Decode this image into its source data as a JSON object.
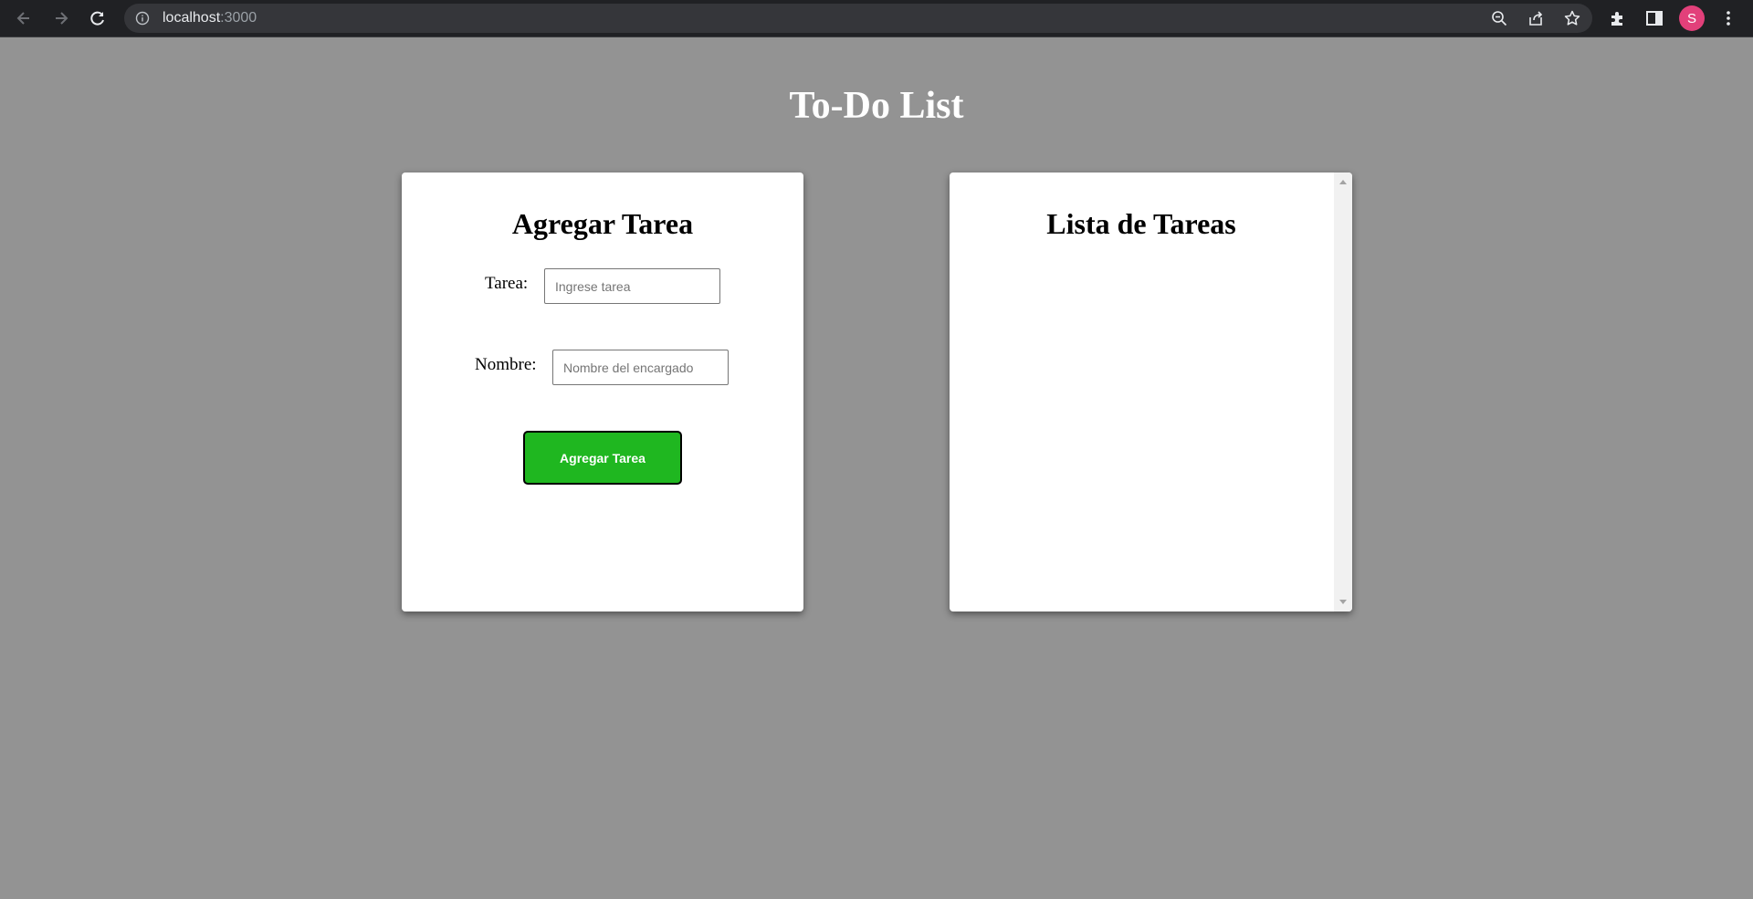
{
  "browser": {
    "url_host": "localhost",
    "url_port": ":3000",
    "profile_initial": "S",
    "icons": {
      "back": "arrow-left-icon",
      "forward": "arrow-right-icon",
      "reload": "reload-icon",
      "site_info": "info-icon",
      "zoom": "zoom-out-icon",
      "share": "share-icon",
      "bookmark": "star-icon",
      "extensions": "puzzle-icon",
      "side_panel": "side-panel-icon",
      "menu": "kebab-menu-icon"
    }
  },
  "page": {
    "title": "To-Do List"
  },
  "add_card": {
    "heading": "Agregar Tarea",
    "task_label": "Tarea:",
    "task_value": "",
    "task_placeholder": "Ingrese tarea",
    "name_label": "Nombre:",
    "name_value": "",
    "name_placeholder": "Nombre del encargado",
    "submit_label": "Agregar Tarea"
  },
  "list_card": {
    "heading": "Lista de Tareas",
    "tasks": []
  },
  "colors": {
    "background": "#939393",
    "button": "#1fb720",
    "card": "#ffffff",
    "avatar": "#e2407a"
  }
}
